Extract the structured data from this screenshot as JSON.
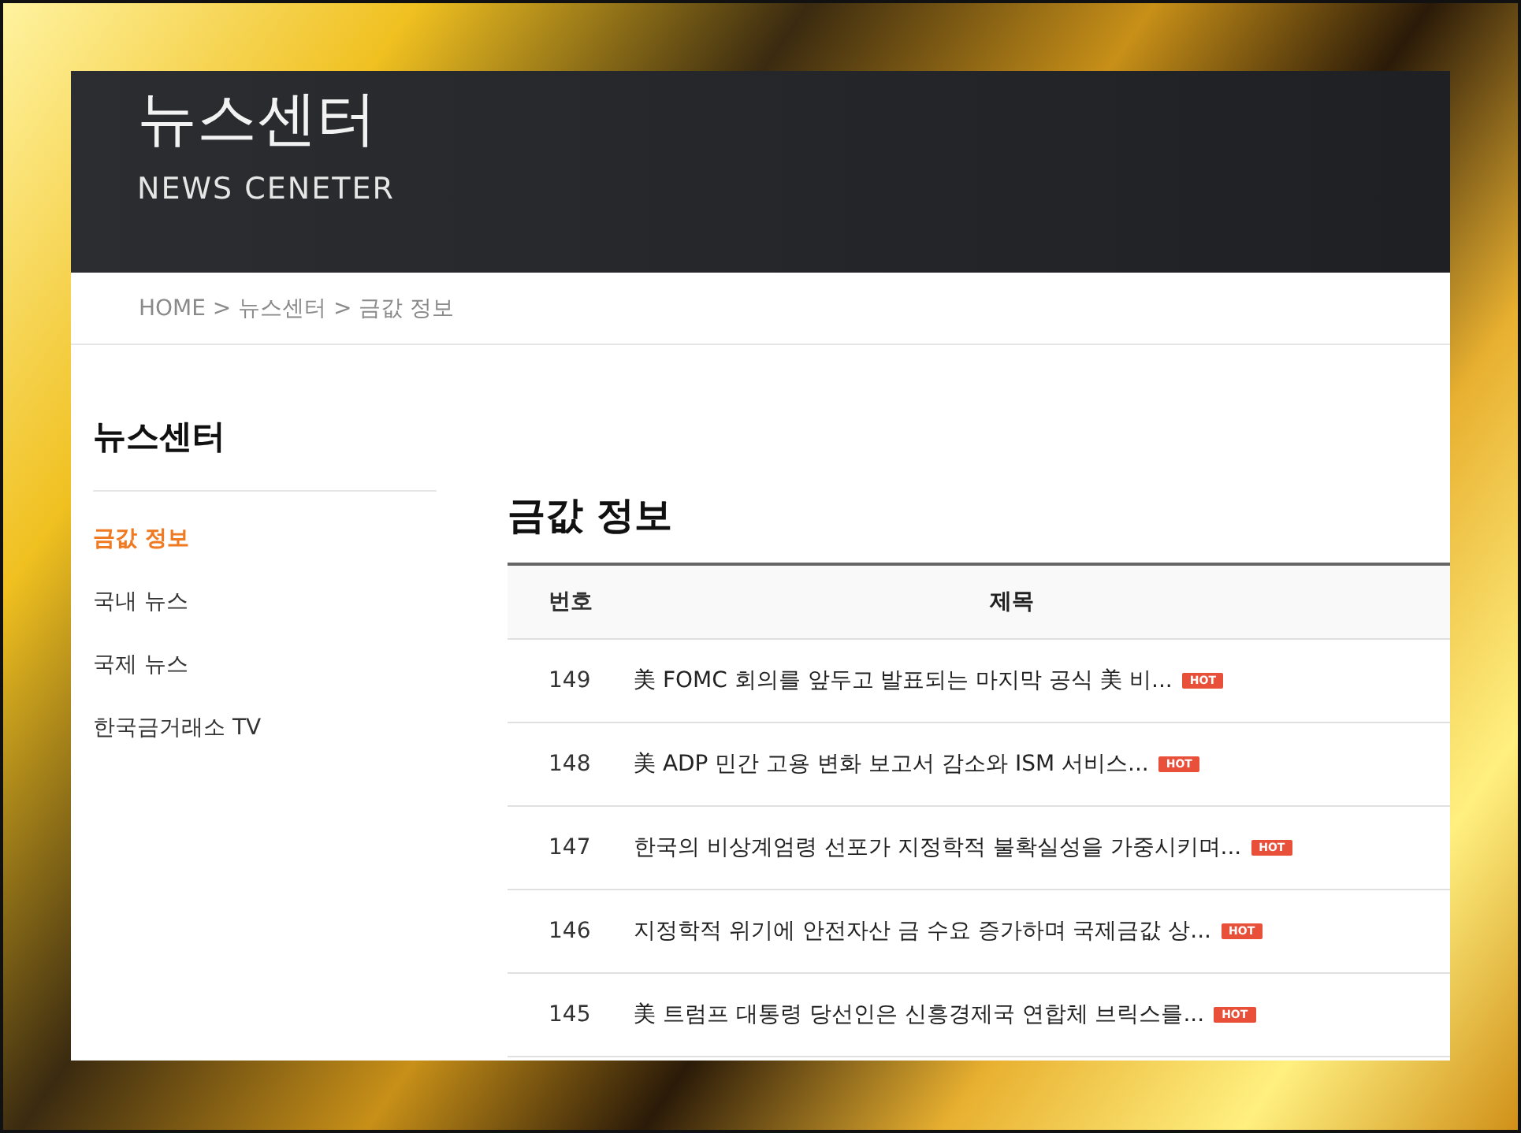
{
  "header": {
    "title": "뉴스센터",
    "subtitle": "NEWS CENETER"
  },
  "breadcrumb": "HOME > 뉴스센터 > 금값 정보",
  "sidebar": {
    "title": "뉴스센터",
    "items": [
      {
        "label": "금값 정보",
        "selected": true
      },
      {
        "label": "국내 뉴스",
        "selected": false
      },
      {
        "label": "국제 뉴스",
        "selected": false
      },
      {
        "label": "한국금거래소 TV",
        "selected": false
      }
    ]
  },
  "content": {
    "title": "금값 정보",
    "table": {
      "columns": [
        "번호",
        "제목"
      ],
      "rows": [
        {
          "number": "149",
          "title": "美 FOMC 회의를 앞두고 발표되는 마지막 공식 美 비...",
          "hot": true,
          "badge": "HOT"
        },
        {
          "number": "148",
          "title": "美 ADP 민간 고용 변화 보고서 감소와 ISM 서비스...",
          "hot": true,
          "badge": "HOT"
        },
        {
          "number": "147",
          "title": "한국의 비상계엄령 선포가 지정학적 불확실성을 가중시키며...",
          "hot": true,
          "badge": "HOT"
        },
        {
          "number": "146",
          "title": "지정학적 위기에 안전자산 금 수요 증가하며 국제금값 상...",
          "hot": true,
          "badge": "HOT"
        },
        {
          "number": "145",
          "title": "美 트럼프 대통령 당선인은 신흥경제국 연합체 브릭스를...",
          "hot": true,
          "badge": "HOT"
        }
      ]
    }
  }
}
